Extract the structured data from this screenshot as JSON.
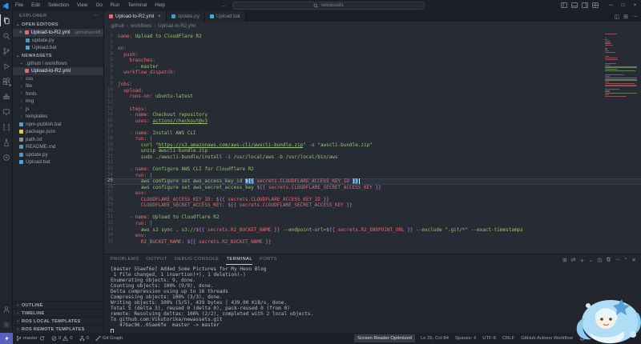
{
  "title_bar": {
    "menus": [
      "File",
      "Edit",
      "Selection",
      "View",
      "Go",
      "Run",
      "Terminal",
      "Help"
    ],
    "history_icons": [
      "back-arrow-icon",
      "forward-arrow-icon"
    ],
    "search": {
      "icon": "search-icon",
      "value": "newassets"
    },
    "layout_icons": [
      "toggle-sidebar-icon",
      "toggle-panel-icon",
      "toggle-secondary-sidebar-icon",
      "customize-layout-icon"
    ],
    "window_controls": [
      {
        "name": "minimize-button",
        "glyph": "─"
      },
      {
        "name": "maximize-button",
        "glyph": "□"
      },
      {
        "name": "close-button",
        "glyph": "×"
      }
    ]
  },
  "activity_bar": {
    "top": [
      {
        "name": "explorer",
        "active": true
      },
      {
        "name": "search",
        "active": false
      },
      {
        "name": "source-control",
        "active": false
      },
      {
        "name": "run-debug",
        "active": false
      },
      {
        "name": "extensions",
        "active": false,
        "badge": true
      },
      {
        "name": "docker",
        "active": false
      },
      {
        "name": "remote-explorer",
        "active": false
      },
      {
        "name": "brackets",
        "active": false
      },
      {
        "name": "test",
        "active": false
      },
      {
        "name": "ros",
        "active": false
      }
    ],
    "bottom": [
      {
        "name": "account",
        "active": false
      },
      {
        "name": "settings",
        "active": false
      }
    ]
  },
  "sidebar": {
    "header": "EXPLORER",
    "header_more": "⋯",
    "open_editors": {
      "title": "OPEN EDITORS",
      "items": [
        {
          "icon": "yml",
          "label": "Upload-to-R2.yml",
          "desc": ".github\\workfl...",
          "active": true,
          "close": "×"
        },
        {
          "icon": "py",
          "label": "update.py",
          "desc": "",
          "active": false,
          "close": ""
        },
        {
          "icon": "bat",
          "label": "Upload.bat",
          "desc": "",
          "active": false,
          "close": ""
        }
      ]
    },
    "workspace": {
      "title": "NEWASSETS",
      "tree": [
        {
          "kind": "folder-open",
          "icon": "folder",
          "label": ".github \\ workflows",
          "indent": 0,
          "active": false
        },
        {
          "kind": "file",
          "icon": "yml",
          "label": "Upload-to-R2.yml",
          "indent": 1,
          "active": true
        },
        {
          "kind": "folder",
          "icon": "folder",
          "label": "css",
          "indent": 0,
          "active": false
        },
        {
          "kind": "folder",
          "icon": "folder",
          "label": "file",
          "indent": 0,
          "active": false
        },
        {
          "kind": "folder",
          "icon": "folder",
          "label": "fonts",
          "indent": 0,
          "active": false
        },
        {
          "kind": "folder",
          "icon": "folder",
          "label": "img",
          "indent": 0,
          "active": false
        },
        {
          "kind": "folder",
          "icon": "folder",
          "label": "js",
          "indent": 0,
          "active": false
        },
        {
          "kind": "folder",
          "icon": "folder",
          "label": "templates",
          "indent": 0,
          "active": false
        },
        {
          "kind": "file",
          "icon": "bat",
          "label": "npm-publish.bat",
          "indent": 0,
          "active": false
        },
        {
          "kind": "file",
          "icon": "json",
          "label": "package.json",
          "indent": 0,
          "active": false
        },
        {
          "kind": "file",
          "icon": "txt",
          "label": "path.txt",
          "indent": 0,
          "active": false
        },
        {
          "kind": "file",
          "icon": "md",
          "label": "README.md",
          "indent": 0,
          "active": false
        },
        {
          "kind": "file",
          "icon": "py",
          "label": "update.py",
          "indent": 0,
          "active": false
        },
        {
          "kind": "file",
          "icon": "bat",
          "label": "Upload.bat",
          "indent": 0,
          "active": false
        }
      ]
    },
    "bottom_sections": [
      "OUTLINE",
      "TIMELINE",
      "ROS LOCAL TEMPLATES",
      "ROS REMOTE TEMPLATES"
    ]
  },
  "editor": {
    "tabs": [
      {
        "icon": "yml",
        "label": "Upload-to-R2.yml",
        "active": true,
        "close": "×"
      },
      {
        "icon": "py",
        "label": "update.py",
        "active": false,
        "close": ""
      },
      {
        "icon": "bat",
        "label": "Upload.bat",
        "active": false,
        "close": ""
      }
    ],
    "tab_actions": [
      "split-editor-icon",
      "toggle-layout-icon",
      "more-actions-icon"
    ],
    "breadcrumb": [
      ".github",
      "workflows",
      "Upload-to-R2.yml"
    ],
    "active_line": 25,
    "lines": [
      {
        "n": 1,
        "segs": [
          [
            "k",
            "name:"
          ],
          [
            "s",
            " Upload to CloudFlare R2"
          ]
        ]
      },
      {
        "n": 2,
        "segs": []
      },
      {
        "n": 3,
        "segs": [
          [
            "k",
            "on:"
          ]
        ]
      },
      {
        "n": 4,
        "segs": [
          [
            "p",
            "  "
          ],
          [
            "k",
            "push:"
          ]
        ]
      },
      {
        "n": 5,
        "segs": [
          [
            "p",
            "    "
          ],
          [
            "k",
            "branches:"
          ]
        ]
      },
      {
        "n": 6,
        "segs": [
          [
            "p",
            "      "
          ],
          [
            "k",
            "- "
          ],
          [
            "s",
            "master"
          ]
        ]
      },
      {
        "n": 7,
        "segs": [
          [
            "p",
            "  "
          ],
          [
            "k",
            "workflow_dispatch:"
          ]
        ]
      },
      {
        "n": 8,
        "segs": []
      },
      {
        "n": 9,
        "segs": [
          [
            "k",
            "jobs:"
          ]
        ]
      },
      {
        "n": 10,
        "segs": [
          [
            "p",
            "  "
          ],
          [
            "k",
            "upload:"
          ]
        ]
      },
      {
        "n": 11,
        "segs": [
          [
            "p",
            "    "
          ],
          [
            "k",
            "runs-on:"
          ],
          [
            "s",
            " ubuntu-latest"
          ]
        ]
      },
      {
        "n": 12,
        "segs": []
      },
      {
        "n": 13,
        "segs": [
          [
            "p",
            "    "
          ],
          [
            "k",
            "steps:"
          ]
        ]
      },
      {
        "n": 14,
        "segs": [
          [
            "p",
            "    "
          ],
          [
            "k",
            "- name:"
          ],
          [
            "s",
            " Checkout repository"
          ]
        ]
      },
      {
        "n": 15,
        "segs": [
          [
            "p",
            "      "
          ],
          [
            "k",
            "uses:"
          ],
          [
            "p",
            " "
          ],
          [
            "u",
            "actions/checkout@v3"
          ]
        ]
      },
      {
        "n": 16,
        "segs": []
      },
      {
        "n": 17,
        "segs": [
          [
            "p",
            "    "
          ],
          [
            "k",
            "- name:"
          ],
          [
            "s",
            " Install AWS CLI"
          ]
        ]
      },
      {
        "n": 18,
        "segs": [
          [
            "p",
            "      "
          ],
          [
            "k",
            "run:"
          ],
          [
            "p",
            " |"
          ]
        ]
      },
      {
        "n": 19,
        "segs": [
          [
            "p",
            "        "
          ],
          [
            "s",
            "curl \""
          ],
          [
            "u",
            "https://s3.amazonaws.com/aws-cli/awscli-bundle.zip"
          ],
          [
            "s",
            "\" -o \"awscli-bundle.zip\""
          ]
        ]
      },
      {
        "n": 20,
        "segs": [
          [
            "p",
            "        "
          ],
          [
            "s",
            "unzip awscli-bundle.zip"
          ]
        ]
      },
      {
        "n": 21,
        "segs": [
          [
            "p",
            "        "
          ],
          [
            "s",
            "sudo ./awscli-bundle/install -i /usr/local/aws -b /usr/local/bin/aws"
          ]
        ]
      },
      {
        "n": 22,
        "segs": []
      },
      {
        "n": 23,
        "segs": [
          [
            "p",
            "    "
          ],
          [
            "k",
            "- name:"
          ],
          [
            "s",
            " Configure AWS CLI for Cloudflare R2"
          ]
        ]
      },
      {
        "n": 24,
        "segs": [
          [
            "p",
            "      "
          ],
          [
            "k",
            "run:"
          ],
          [
            "p",
            " |"
          ]
        ]
      },
      {
        "n": 25,
        "segs": [
          [
            "p",
            "        "
          ],
          [
            "s",
            "aws configure set aws_access_key_id "
          ],
          [
            "sel",
            "${{"
          ],
          [
            "c",
            " secrets.CLOUDFLARE_ACCESS_KEY_ID "
          ],
          [
            "sel",
            "}}"
          ]
        ]
      },
      {
        "n": 26,
        "segs": [
          [
            "p",
            "        "
          ],
          [
            "s",
            "aws configure set aws_secret_access_key "
          ],
          [
            "x",
            "${{"
          ],
          [
            "c",
            " secrets.CLOUDFLARE_SECRET_ACCESS_KEY "
          ],
          [
            "x",
            "}}"
          ]
        ]
      },
      {
        "n": 27,
        "segs": [
          [
            "p",
            "      "
          ],
          [
            "k",
            "env:"
          ]
        ]
      },
      {
        "n": 28,
        "segs": [
          [
            "p",
            "        "
          ],
          [
            "k",
            "CLOUDFLARE_ACCESS_KEY_ID:"
          ],
          [
            "p",
            " "
          ],
          [
            "x",
            "${{"
          ],
          [
            "c",
            " secrets.CLOUDFLARE_ACCESS_KEY_ID "
          ],
          [
            "x",
            "}}"
          ]
        ]
      },
      {
        "n": 29,
        "segs": [
          [
            "p",
            "        "
          ],
          [
            "k",
            "CLOUDFLARE_SECRET_ACCESS_KEY:"
          ],
          [
            "p",
            " "
          ],
          [
            "x",
            "${{"
          ],
          [
            "c",
            " secrets.CLOUDFLARE_SECRET_ACCESS_KEY "
          ],
          [
            "x",
            "}}"
          ]
        ]
      },
      {
        "n": 30,
        "segs": []
      },
      {
        "n": 31,
        "segs": [
          [
            "p",
            "    "
          ],
          [
            "k",
            "- name:"
          ],
          [
            "s",
            " Upload to Cloudflare R2"
          ]
        ]
      },
      {
        "n": 32,
        "segs": [
          [
            "p",
            "      "
          ],
          [
            "k",
            "run:"
          ],
          [
            "p",
            " |"
          ]
        ]
      },
      {
        "n": 33,
        "segs": [
          [
            "p",
            "        "
          ],
          [
            "s",
            "aws s3 sync . s3://"
          ],
          [
            "x",
            "${{"
          ],
          [
            "c",
            " secrets.R2_BUCKET_NAME "
          ],
          [
            "x",
            "}}"
          ],
          [
            "s",
            " --endpoint-url="
          ],
          [
            "x",
            "${{"
          ],
          [
            "c",
            " secrets.R2_ENDPOINT_URL "
          ],
          [
            "x",
            "}}"
          ],
          [
            "s",
            " --exclude \".git/*\" --exact-timestamps"
          ]
        ]
      },
      {
        "n": 34,
        "segs": [
          [
            "p",
            "      "
          ],
          [
            "k",
            "env:"
          ]
        ]
      },
      {
        "n": 35,
        "segs": [
          [
            "p",
            "        "
          ],
          [
            "k",
            "R2_BUCKET_NAME:"
          ],
          [
            "p",
            " "
          ],
          [
            "x",
            "${{"
          ],
          [
            "c",
            " secrets.R2_BUCKET_NAME "
          ],
          [
            "x",
            "}}"
          ]
        ]
      }
    ]
  },
  "panel": {
    "tabs": [
      {
        "label": "PROBLEMS",
        "active": false
      },
      {
        "label": "OUTPUT",
        "active": false
      },
      {
        "label": "DEBUG CONSOLE",
        "active": false
      },
      {
        "label": "TERMINAL",
        "active": true
      },
      {
        "label": "PORTS",
        "active": false
      }
    ],
    "actions": [
      "terminal-tabs-icon",
      "git-shell-icon",
      "new-terminal-icon",
      "terminal-dropdown-icon",
      "split-terminal-icon",
      "kill-terminal-icon",
      "minimize-panel-icon",
      "maximize-panel-icon",
      "close-panel-icon"
    ],
    "terminal_lines": [
      "[master 55aef6e] Added Some Pictures for My Hexo Blog",
      " 1 file changed, 1 insertion(+), 1 deletion(-)",
      "Enumerating objects: 9, done.",
      "Counting objects: 100% (9/9), done.",
      "Delta compression using up to 16 threads",
      "Compressing objects: 100% (3/3), done.",
      "Writing objects: 100% (5/5), 439 bytes | 439.00 KiB/s, done.",
      "Total 5 (delta 3), reused 0 (delta 0), pack-reused 0 (from 0)",
      "remote: Resolving deltas: 100% (2/2), completed with 2 local objects.",
      "To github.com:Vikutorika/newassets.git",
      "   476ac96..05ae6fe  master -> master"
    ]
  },
  "status_bar": {
    "left": [
      {
        "name": "remote-indicator",
        "icon": "zap",
        "label": ""
      },
      {
        "name": "branch-item",
        "icon": "branch",
        "label": "master",
        "icon2": "sync"
      },
      {
        "name": "problems-item",
        "icon": "error",
        "label": "0",
        "icon2": "warn",
        "label2": "0"
      },
      {
        "name": "fork-item",
        "icon": "fork",
        "label": "0"
      },
      {
        "name": "git-graph-item",
        "icon": "graph",
        "label": "Git Graph"
      }
    ],
    "right": [
      {
        "name": "screen-reader-item",
        "label": "Screen Reader Optimized",
        "chip": true
      },
      {
        "name": "cursor-position",
        "label": "Ln 25, Col 84"
      },
      {
        "name": "indentation",
        "label": "Spaces: 4"
      },
      {
        "name": "encoding",
        "label": "UTF-8"
      },
      {
        "name": "eol",
        "label": "CRLF"
      },
      {
        "name": "language-mode",
        "label": "GitHub Actions Workflow"
      },
      {
        "name": "notifications-bell",
        "icon": "bell",
        "label": ""
      }
    ]
  },
  "colors": {
    "accent_blue": "#316dca",
    "key_red": "#e06c75",
    "string_green": "#98c379",
    "expr_purple": "#c678dd",
    "selection_blue": "#3f6fa6",
    "remote_chip": "#5a5fc0",
    "file_icon_yml": "#e06c75",
    "file_icon_py": "#519aba",
    "file_icon_bat": "#4fa3d1",
    "file_icon_json": "#e8c264",
    "file_icon_txt": "#8b939f",
    "file_icon_md": "#519aba"
  }
}
